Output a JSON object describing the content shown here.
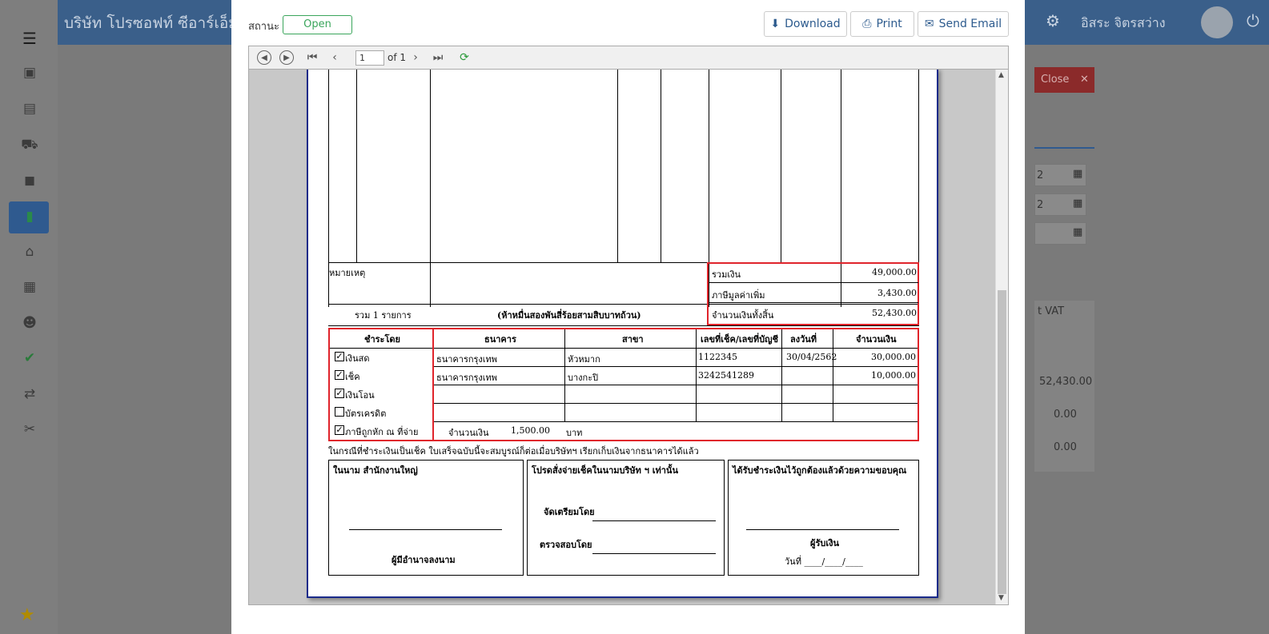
{
  "app": {
    "company": "บริษัท โปรซอฟท์ ซีอาร์เอ็ม จำ",
    "user": "อิสระ จิตรสว่าง",
    "close_label": "Close",
    "bg_values": [
      "52,430.00",
      "0.00",
      "0.00"
    ],
    "bg_vat": "t VAT",
    "bg_dates": [
      "2",
      "2",
      ""
    ]
  },
  "modal": {
    "status_label": "สถานะ",
    "status_value": "Open",
    "buttons": {
      "download": "Download",
      "print": "Print",
      "email": "Send Email"
    },
    "toolbar": {
      "page": "1",
      "of": "of 1"
    }
  },
  "receipt": {
    "remark_label": "หมายเหตุ",
    "total_items": "รวม 1 รายการ",
    "amount_words": "(ห้าหมื่นสองพันสี่ร้อยสามสิบบาทถ้วน)",
    "summary": [
      {
        "label": "รวมเงิน",
        "value": "49,000.00"
      },
      {
        "label": "ภาษีมูลค่าเพิ่ม",
        "value": "3,430.00"
      },
      {
        "label": "จำนวนเงินทั้งสิ้น",
        "value": "52,430.00"
      }
    ],
    "payment_header": "ชำระโดย",
    "payment_methods": [
      {
        "label": "เงินสด",
        "checked": true
      },
      {
        "label": "เช็ค",
        "checked": true
      },
      {
        "label": "เงินโอน",
        "checked": true
      },
      {
        "label": "บัตรเครดิต",
        "checked": false
      },
      {
        "label": "ภาษีถูกหัก ณ ที่จ่าย",
        "checked": true
      }
    ],
    "columns": [
      "ธนาคาร",
      "สาขา",
      "เลขที่เช็ค/เลขที่บัญชี",
      "ลงวันที่",
      "จำนวนเงิน"
    ],
    "rows": [
      {
        "bank": "ธนาคารกรุงเทพ",
        "branch": "หัวหมาก",
        "number": "1122345",
        "date": "30/04/2562",
        "amount": "30,000.00"
      },
      {
        "bank": "ธนาคารกรุงเทพ",
        "branch": "บางกะปิ",
        "number": "3242541289",
        "date": "",
        "amount": "10,000.00"
      }
    ],
    "wht_label": "จำนวนเงิน",
    "wht_value": "1,500.00",
    "wht_unit": "บาท",
    "note": "ในกรณีที่ชำระเงินเป็นเช็ค ใบเสร็จฉบับนี้จะสมบูรณ์ก็ต่อเมื่อบริษัทฯ เรียกเก็บเงินจากธนาคารได้แล้ว",
    "sig1_title": "ในนาม สำนักงานใหญ่",
    "sig1_label": "ผู้มีอำนาจลงนาม",
    "sig2_title": "โปรดสั่งจ่ายเช็คในนามบริษัท ฯ เท่านั้น",
    "sig2_prepared": "จัดเตรียมโดย",
    "sig2_checked": "ตรวจสอบโดย",
    "sig3_title": "ได้รับชำระเงินไว้ถูกต้องแล้วด้วยความขอบคุณ",
    "sig3_label": "ผู้รับเงิน",
    "sig3_date": "วันที่ ____/____/____"
  }
}
